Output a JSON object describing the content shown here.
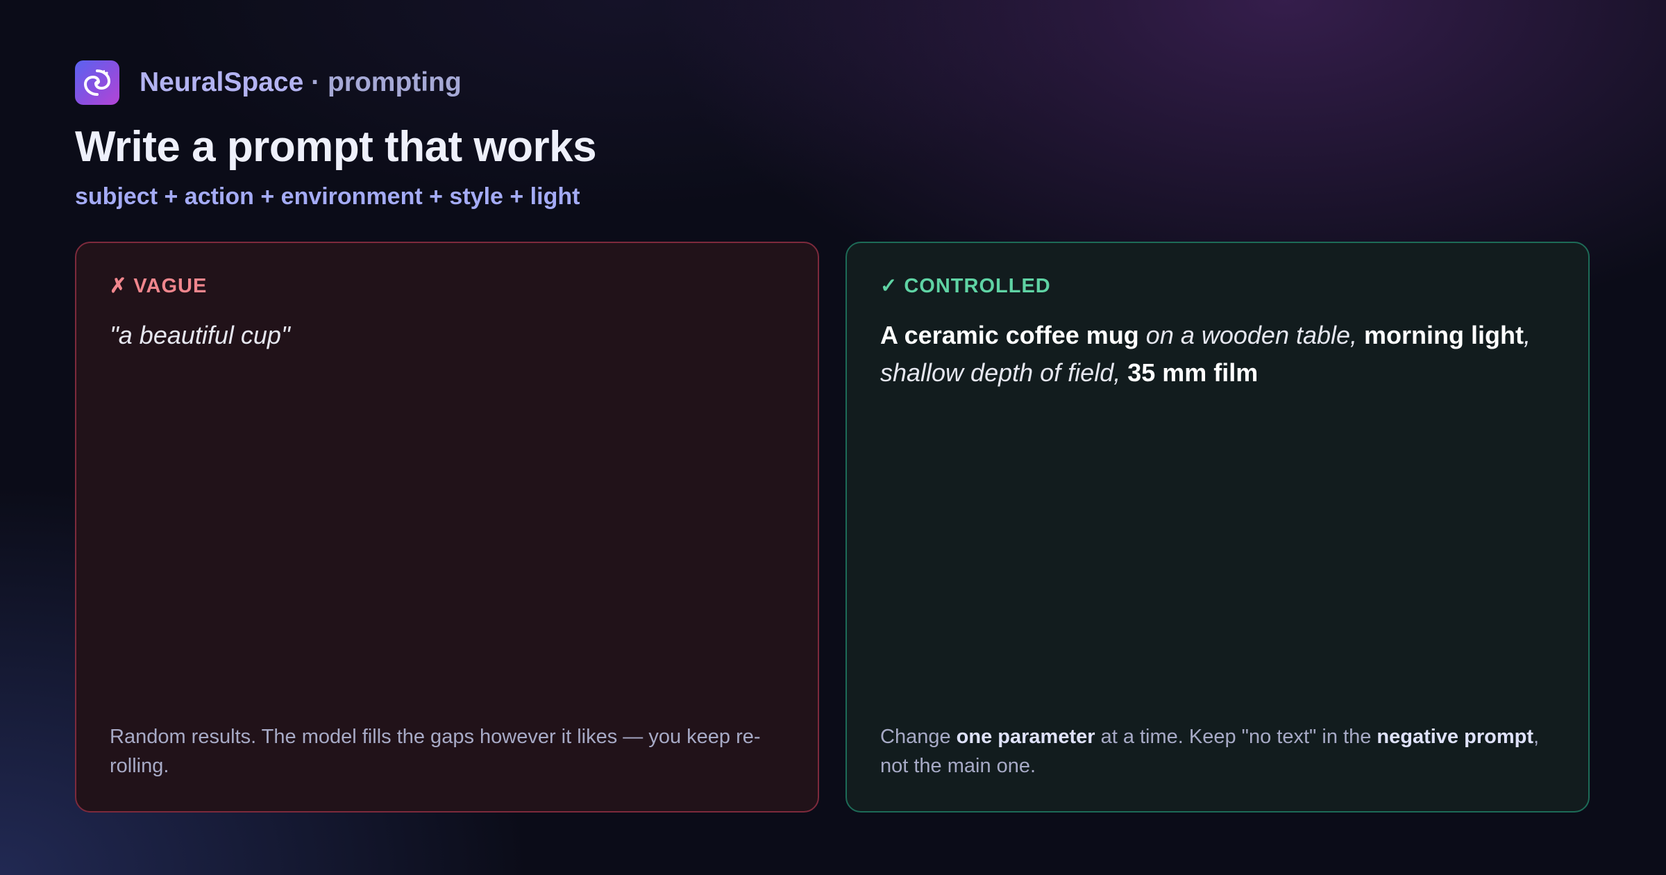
{
  "header": {
    "logo_icon": "galaxy-swirl-icon",
    "brand_name": "NeuralSpace",
    "separator": "·",
    "section": "prompting",
    "title": "Write a prompt that works",
    "formula": "subject + action + environment + style + light"
  },
  "cards": {
    "vague": {
      "tag": "✗ VAGUE",
      "prompt": "\"a beautiful cup\"",
      "note": "Random results. The model fills the gaps however it likes — you keep re-rolling."
    },
    "controlled": {
      "tag": "✓ CONTROLLED",
      "prompt_parts": [
        "A ceramic coffee mug",
        " on a wooden table, ",
        "morning light",
        ",",
        " shallow depth of field, ",
        "35 mm film"
      ],
      "note_parts": [
        "Change ",
        "one parameter",
        " at a time. Keep \"no text\" in the ",
        "negative prompt",
        ", not the main one."
      ]
    }
  },
  "colors": {
    "background": "#0b0c18",
    "vague_accent": "#f0868d",
    "vague_border": "#7d2a3c",
    "controlled_accent": "#5fd3a4",
    "controlled_border": "#1d6b57",
    "formula": "#a4abf5"
  }
}
